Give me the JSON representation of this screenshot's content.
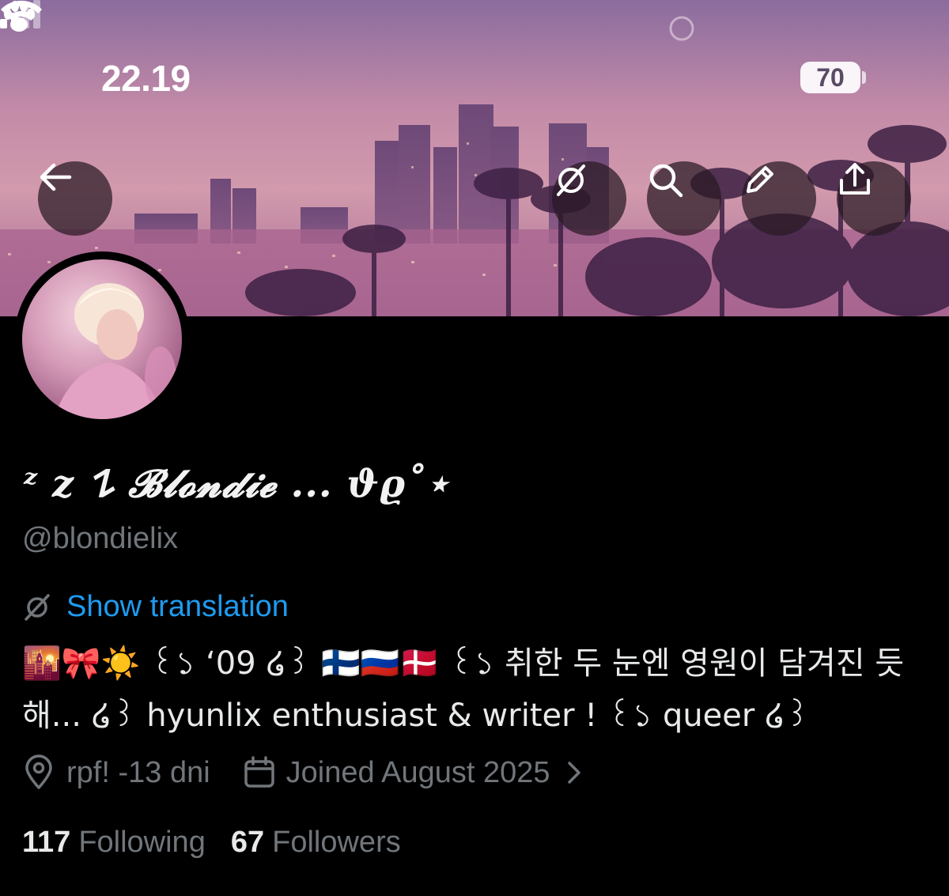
{
  "status_bar": {
    "time": "22.19",
    "battery": "70"
  },
  "header_buttons": {
    "back": "back-arrow-icon",
    "translate": "translate-icon",
    "search": "search-icon",
    "edit": "pencil-icon",
    "share": "share-icon"
  },
  "profile": {
    "display_name": "ᶻ z 𐰁 𝓑𝓵𝓸𝓷𝓭𝓲𝓮 ... ϑϱ˚⋆",
    "handle": "@blondielix",
    "translation_label": "Show translation",
    "bio": "🌇🎀☀️ ꒰১ ‘09 ໒꒱ 🇫🇮🇷🇺🇩🇰 ꒰১ 취한 두 눈엔 영원이 담겨진 듯해... ໒꒱ hyunlix enthusiast & writer ! ꒰১ queer ໒꒱",
    "location": "rpf! -13 dni",
    "joined": "Joined August 2025"
  },
  "stats": {
    "following_count": "117",
    "following_label": "Following",
    "followers_count": "67",
    "followers_label": "Followers"
  },
  "colors": {
    "link": "#1d9bf0",
    "secondary_text": "#71767b",
    "background": "#000000"
  }
}
